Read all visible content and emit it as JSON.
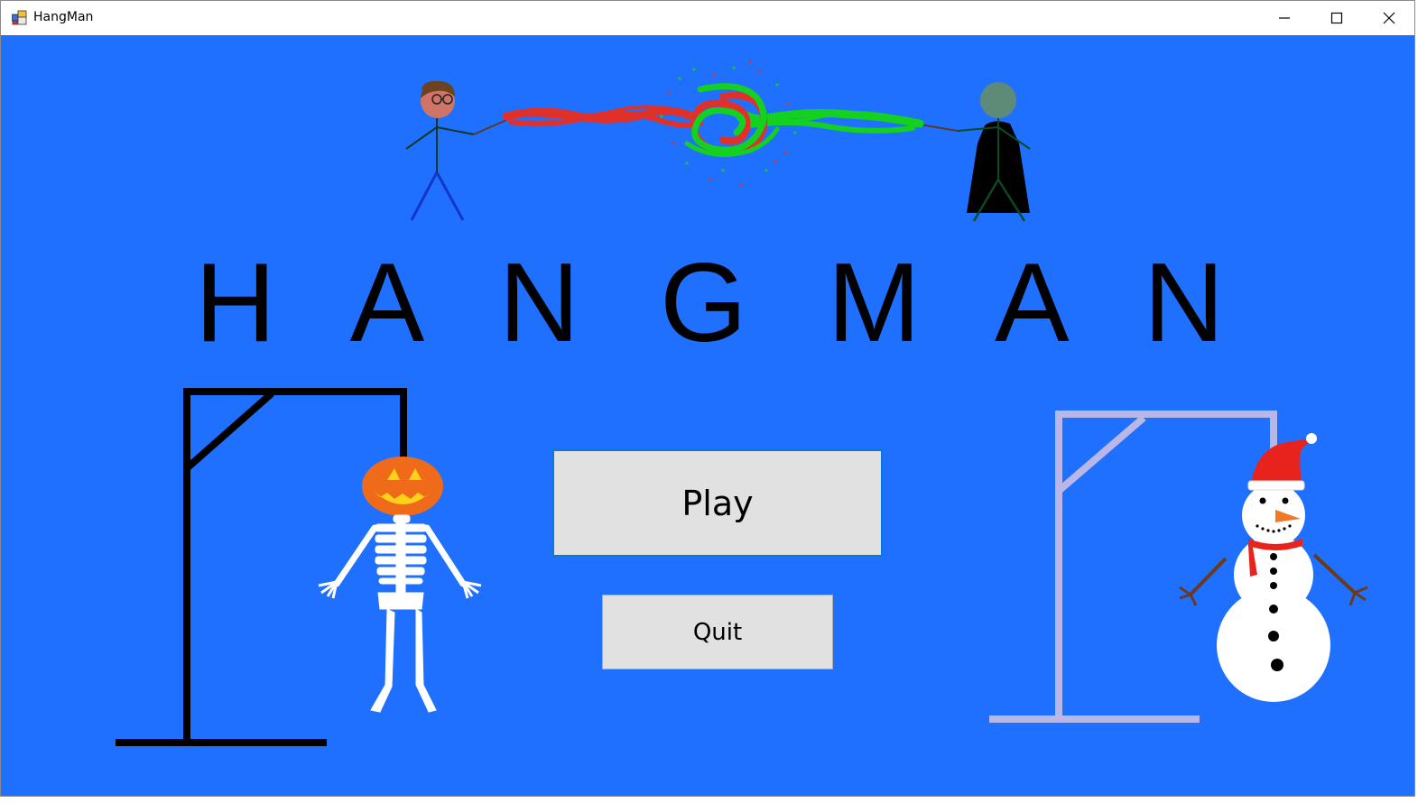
{
  "window": {
    "title": "HangMan",
    "controls": [
      "minimize-icon",
      "maximize-icon",
      "close-icon"
    ]
  },
  "main": {
    "title": "H A N G M A N",
    "play_label": "Play",
    "quit_label": "Quit"
  },
  "illustrations": [
    "wizard-duel-illustration",
    "skeleton-gallows-illustration",
    "snowman-gallows-illustration"
  ],
  "colors": {
    "background": "#1f70ff",
    "button": "#e1e1e1",
    "button_focus_border": "#0a78d7",
    "spell_red": "#e0302a",
    "spell_green": "#14d020",
    "pumpkin": "#ef6b1a"
  }
}
